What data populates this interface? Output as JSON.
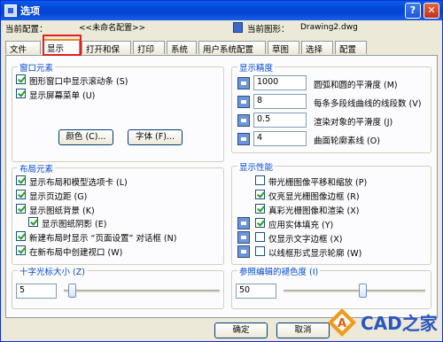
{
  "window": {
    "title": "选项",
    "help_glyph": "?",
    "close_glyph": "✕"
  },
  "header": {
    "profile_label": "当前配置：",
    "profile_value": "<<未命名配置>>",
    "drawing_label": "当前图形：",
    "drawing_value": "Drawing2.dwg"
  },
  "tabs": [
    "文件",
    "显示",
    "打开和保存",
    "打印",
    "系统",
    "用户系统配置",
    "草图",
    "选择",
    "配置"
  ],
  "window_elements": {
    "title": "窗口元素",
    "checkboxes": [
      {
        "label": "图形窗口中显示滚动条 (S)",
        "checked": true
      },
      {
        "label": "显示屏幕菜单 (U)",
        "checked": true
      }
    ],
    "colors_button": "颜色 (C)...",
    "fonts_button": "字体 (F)..."
  },
  "layout_elements": {
    "title": "布局元素",
    "checkboxes": [
      {
        "label": "显示布局和模型选项卡 (L)",
        "checked": true
      },
      {
        "label": "显示页边距 (G)",
        "checked": true
      },
      {
        "label": "显示图纸背景 (K)",
        "checked": true
      },
      {
        "label": "显示图纸阴影 (E)",
        "checked": true
      },
      {
        "label": "新建布局时显示 “页面设置” 对话框 (N)",
        "checked": true
      },
      {
        "label": "在新布局中创建视口 (W)",
        "checked": true
      }
    ]
  },
  "crosshair": {
    "title": "十字光标大小 (Z)",
    "value": "5",
    "level": 5
  },
  "resolution": {
    "title": "显示精度",
    "rows": [
      {
        "value": "1000",
        "label": "圆弧和圆的平滑度 (M)"
      },
      {
        "value": "8",
        "label": "每条多段线曲线的线段数 (V)"
      },
      {
        "value": "0.5",
        "label": "渲染对象的平滑度 (J)"
      },
      {
        "value": "4",
        "label": "曲面轮廓素线 (O)"
      }
    ]
  },
  "performance": {
    "title": "显示性能",
    "checkboxes": [
      {
        "label": "带光栅图像平移和缩放 (P)",
        "checked": false,
        "icon": false
      },
      {
        "label": "仅亮显光栅图像边框 (R)",
        "checked": true,
        "icon": false
      },
      {
        "label": "真彩光栅图像和渲染 (X)",
        "checked": true,
        "icon": false
      },
      {
        "label": "应用实体填充 (Y)",
        "checked": true,
        "icon": true
      },
      {
        "label": "仅显示文字边框 (X)",
        "checked": false,
        "icon": true
      },
      {
        "label": "以线框形式显示轮廓 (W)",
        "checked": false,
        "icon": true
      }
    ]
  },
  "fade": {
    "title": "参照编辑的褪色度 (I)",
    "value": "50",
    "level": 50
  },
  "buttons": {
    "ok": "确定",
    "cancel": "取消"
  },
  "watermark": {
    "text": "CAD之家",
    "logo_glyph": "A"
  }
}
